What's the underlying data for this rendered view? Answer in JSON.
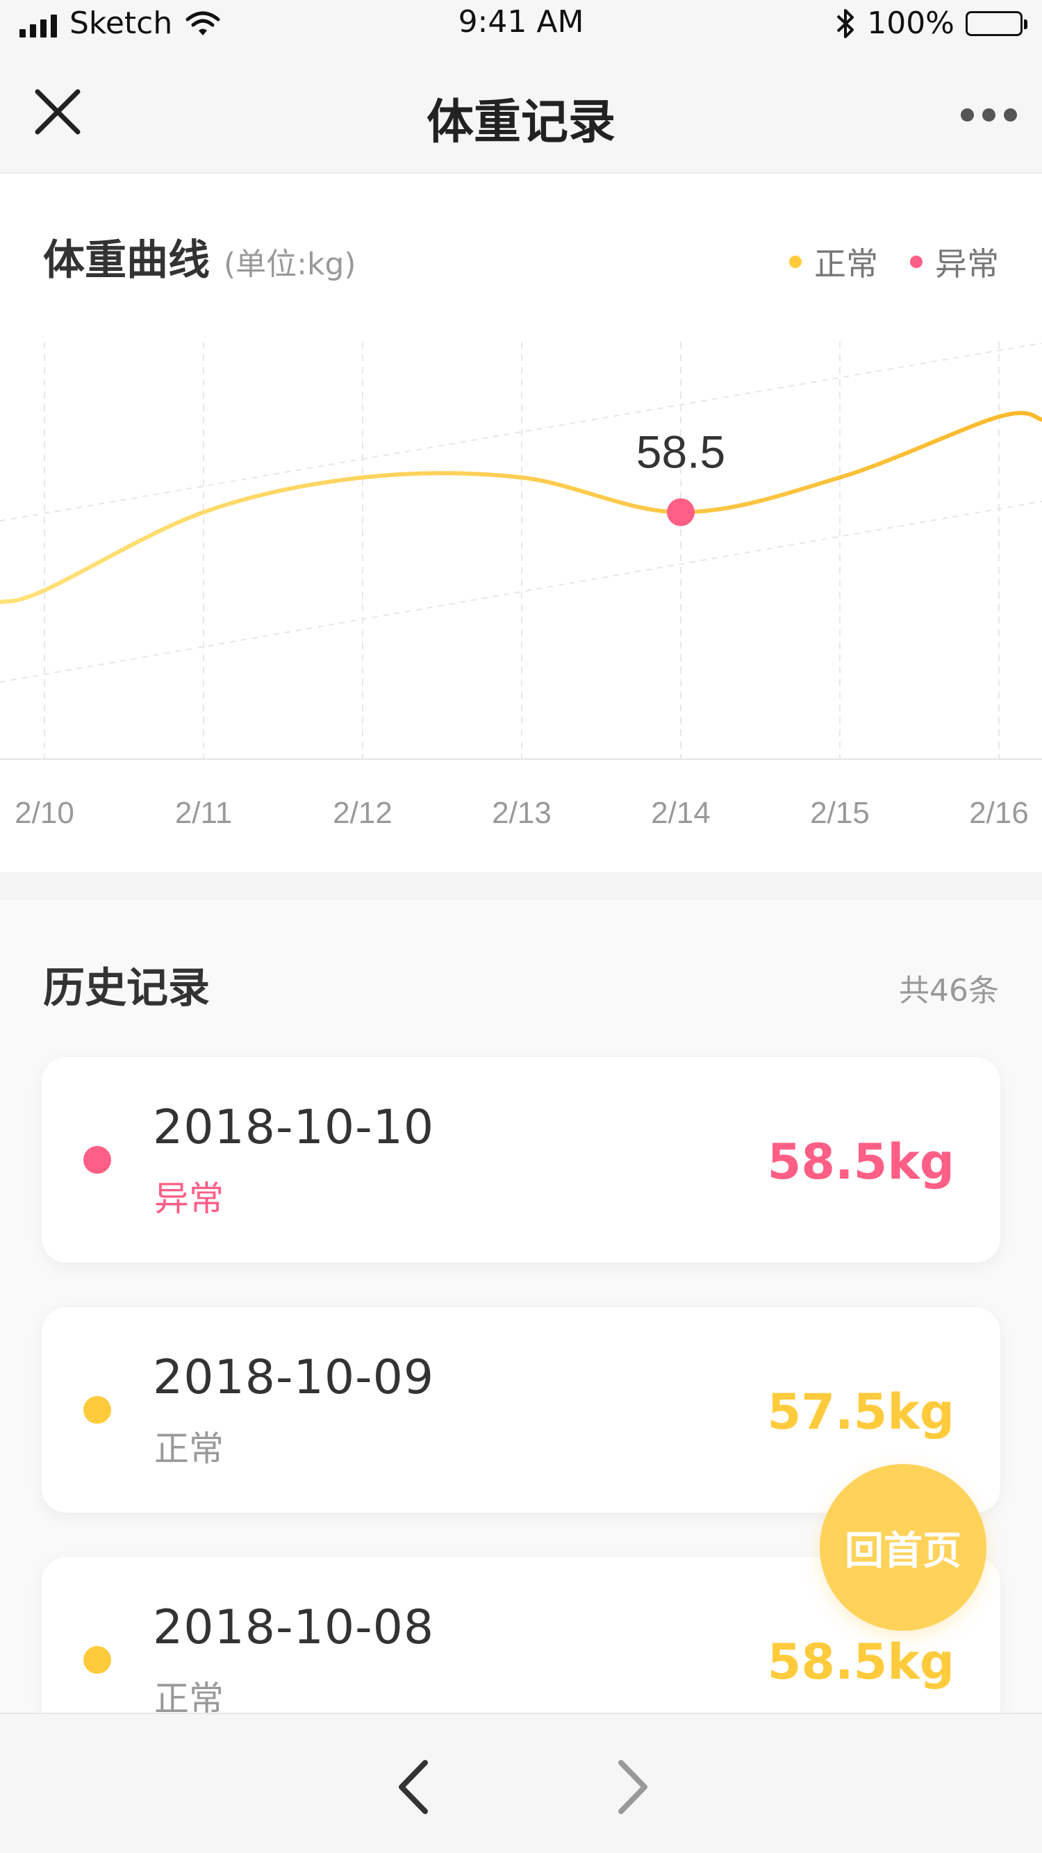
{
  "status_bar": {
    "carrier": "Sketch",
    "time": "9:41 AM",
    "battery": "100%",
    "icons": [
      "signal-icon",
      "wifi-icon",
      "bluetooth-icon",
      "battery-icon"
    ]
  },
  "nav": {
    "title": "体重记录",
    "close_icon": "close-icon",
    "more_icon": "more-icon"
  },
  "chart": {
    "title": "体重曲线",
    "unit": "(单位:kg)",
    "legend": [
      {
        "label": "正常",
        "color": "#ffcb3d"
      },
      {
        "label": "异常",
        "color": "#ff5f86"
      }
    ],
    "highlight_label": "58.5"
  },
  "chart_data": {
    "type": "line",
    "categories": [
      "2/10",
      "2/11",
      "2/12",
      "2/13",
      "2/14",
      "2/15",
      "2/16"
    ],
    "series": [
      {
        "values": [
          57.6,
          58.5,
          58.9,
          58.9,
          58.5,
          58.9,
          59.6
        ]
      }
    ],
    "highlight": {
      "category": "2/14",
      "value": 58.5,
      "status": "异常"
    },
    "grid": true,
    "colors": {
      "line_start": "#ffe27a",
      "line_end": "#fbb92b",
      "highlight": "#ff5f86"
    }
  },
  "history": {
    "title": "历史记录",
    "count": "共46条",
    "records": [
      {
        "date": "2018-10-10",
        "status": "异常",
        "weight": "58.5kg",
        "color": "#ff5f86",
        "status_color": "#ff5f86"
      },
      {
        "date": "2018-10-09",
        "status": "正常",
        "weight": "57.5kg",
        "color": "#ffcb3d",
        "status_color": "#999999"
      },
      {
        "date": "2018-10-08",
        "status": "正常",
        "weight": "58.5kg",
        "color": "#ffcb3d",
        "status_color": "#999999"
      }
    ]
  },
  "home_button": {
    "label": "回首页"
  },
  "bottom_bar": {
    "back_icon": "chevron-left-icon",
    "forward_icon": "chevron-right-icon"
  }
}
